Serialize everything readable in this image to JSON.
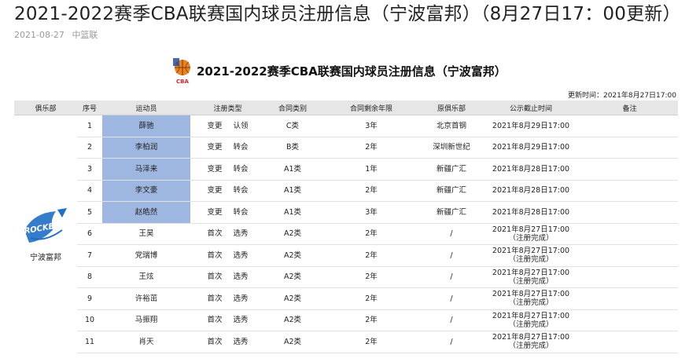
{
  "page": {
    "title": "2021-2022赛季CBA联赛国内球员注册信息（宁波富邦）（8月27日17：00更新）",
    "date": "2021-08-27",
    "source": "中篮联"
  },
  "doc": {
    "title": "2021-2022赛季CBA联赛国内球员注册信息（宁波富邦）",
    "logo_text": "CBA",
    "update_time": "更新时间：2021年8月27日17:00"
  },
  "table": {
    "headers": [
      "俱乐部",
      "序号",
      "运动员",
      "注册类型",
      "合同类别",
      "合同剩余年限",
      "原俱乐部",
      "公示截止时间",
      "备注"
    ],
    "club": {
      "name": "宁波富邦",
      "logo_text": "ROCKETS"
    },
    "rows": [
      {
        "no": "1",
        "name": "薛驰",
        "reg1": "变更",
        "reg2": "认领",
        "contract": "C类",
        "years": "3年",
        "prev": "北京首钢",
        "deadline": "2021年8月29日17:00",
        "deadline2": "",
        "note": "",
        "highlight": true
      },
      {
        "no": "2",
        "name": "李柏润",
        "reg1": "变更",
        "reg2": "转会",
        "contract": "B类",
        "years": "2年",
        "prev": "深圳新世纪",
        "deadline": "2021年8月29日17:00",
        "deadline2": "",
        "note": "",
        "highlight": true
      },
      {
        "no": "3",
        "name": "马泽来",
        "reg1": "变更",
        "reg2": "转会",
        "contract": "A1类",
        "years": "1年",
        "prev": "新疆广汇",
        "deadline": "2021年8月28日17:00",
        "deadline2": "",
        "note": "",
        "highlight": true
      },
      {
        "no": "4",
        "name": "李文豪",
        "reg1": "变更",
        "reg2": "转会",
        "contract": "A1类",
        "years": "2年",
        "prev": "新疆广汇",
        "deadline": "2021年8月28日17:00",
        "deadline2": "",
        "note": "",
        "highlight": true
      },
      {
        "no": "5",
        "name": "赵皓然",
        "reg1": "变更",
        "reg2": "转会",
        "contract": "A1类",
        "years": "3年",
        "prev": "新疆广汇",
        "deadline": "2021年8月28日17:00",
        "deadline2": "",
        "note": "",
        "highlight": true
      },
      {
        "no": "6",
        "name": "王昊",
        "reg1": "首次",
        "reg2": "选秀",
        "contract": "A2类",
        "years": "2年",
        "prev": "/",
        "deadline": "2021年8月27日17:00",
        "deadline2": "（注册完成）",
        "note": "",
        "highlight": false
      },
      {
        "no": "7",
        "name": "党瑞博",
        "reg1": "首次",
        "reg2": "选秀",
        "contract": "A2类",
        "years": "2年",
        "prev": "/",
        "deadline": "2021年8月27日17:00",
        "deadline2": "（注册完成）",
        "note": "",
        "highlight": false
      },
      {
        "no": "8",
        "name": "王炫",
        "reg1": "首次",
        "reg2": "选秀",
        "contract": "A2类",
        "years": "2年",
        "prev": "/",
        "deadline": "2021年8月27日17:00",
        "deadline2": "（注册完成）",
        "note": "",
        "highlight": false
      },
      {
        "no": "9",
        "name": "许裕茁",
        "reg1": "首次",
        "reg2": "选秀",
        "contract": "A2类",
        "years": "2年",
        "prev": "/",
        "deadline": "2021年8月27日17:00",
        "deadline2": "（注册完成）",
        "note": "",
        "highlight": false
      },
      {
        "no": "10",
        "name": "马振翔",
        "reg1": "首次",
        "reg2": "选秀",
        "contract": "A2类",
        "years": "2年",
        "prev": "/",
        "deadline": "2021年8月27日17:00",
        "deadline2": "（注册完成）",
        "note": "",
        "highlight": false
      },
      {
        "no": "11",
        "name": "肖天",
        "reg1": "首次",
        "reg2": "选秀",
        "contract": "A2类",
        "years": "2年",
        "prev": "/",
        "deadline": "2021年8月27日17:00",
        "deadline2": "（注册完成）",
        "note": "",
        "highlight": false
      }
    ]
  },
  "colors": {
    "header_bg": "#e6e6e6",
    "name_highlight": "#9eb7e0",
    "cba_red": "#d4262c",
    "rockets_blue": "#1f6fc4"
  }
}
